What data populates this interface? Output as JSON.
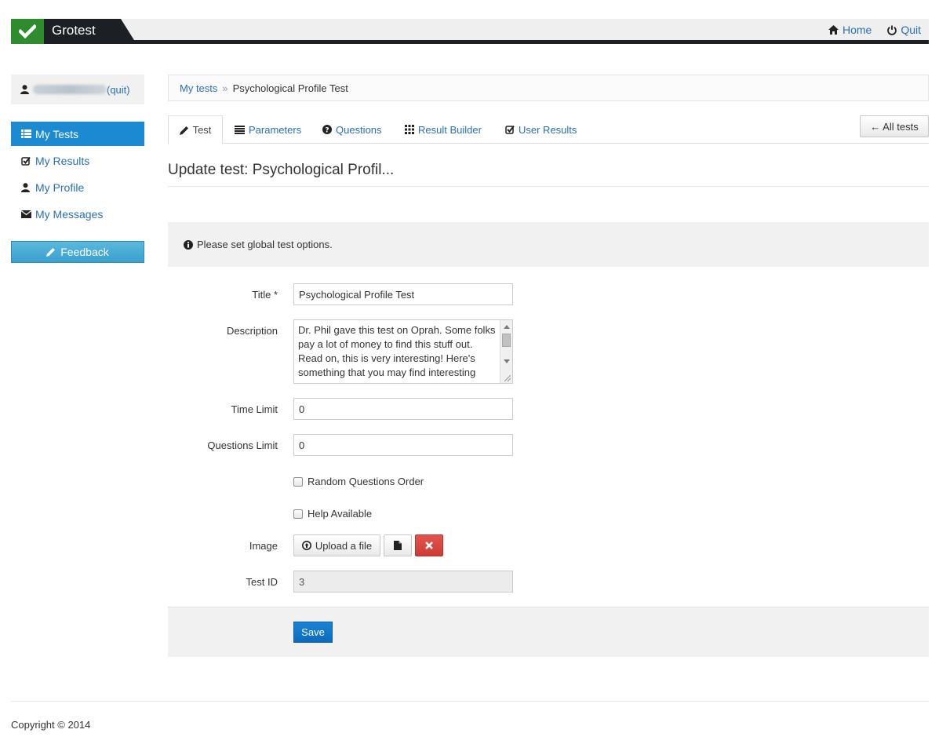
{
  "app": {
    "brand": "Grotest",
    "accent_color": "#1b8ad2",
    "logo_color": "#2e8b2e"
  },
  "topnav": {
    "home_label": "Home",
    "quit_label": "Quit"
  },
  "user": {
    "quit_link": "(quit)"
  },
  "sidebar": {
    "items": [
      {
        "label": "My Tests",
        "icon": "list-icon",
        "active": true
      },
      {
        "label": "My Results",
        "icon": "check-square-icon"
      },
      {
        "label": "My Profile",
        "icon": "user-icon"
      },
      {
        "label": "My Messages",
        "icon": "envelope-icon"
      }
    ],
    "feedback_label": "Feedback"
  },
  "breadcrumb": {
    "root": "My tests",
    "separator": "»",
    "current": "Psychological Profile Test"
  },
  "tabs": [
    {
      "label": "Test",
      "icon": "pencil-icon",
      "active": true
    },
    {
      "label": "Parameters",
      "icon": "list-lines-icon"
    },
    {
      "label": "Questions",
      "icon": "question-circle-icon"
    },
    {
      "label": "Result Builder",
      "icon": "grid-icon"
    },
    {
      "label": "User Results",
      "icon": "check-square-icon"
    }
  ],
  "all_tests_label": "← All tests",
  "page_title": "Update test: Psychological Profil...",
  "info_message": "Please set global test options.",
  "form": {
    "title_label": "Title *",
    "title_value": "Psychological Profile Test",
    "description_label": "Description",
    "description_value": "Dr. Phil gave this test on Oprah. Some folks pay a lot of money to find this stuff out. Read on, this is very interesting! Here's something that you may find interesting",
    "time_limit_label": "Time Limit",
    "time_limit_value": "0",
    "questions_limit_label": "Questions Limit",
    "questions_limit_value": "0",
    "random_order_label": "Random Questions Order",
    "help_available_label": "Help Available",
    "image_label": "Image",
    "upload_label": "Upload a file",
    "test_id_label": "Test ID",
    "test_id_value": "3",
    "save_label": "Save"
  },
  "footer": {
    "copyright": "Copyright © 2014"
  }
}
